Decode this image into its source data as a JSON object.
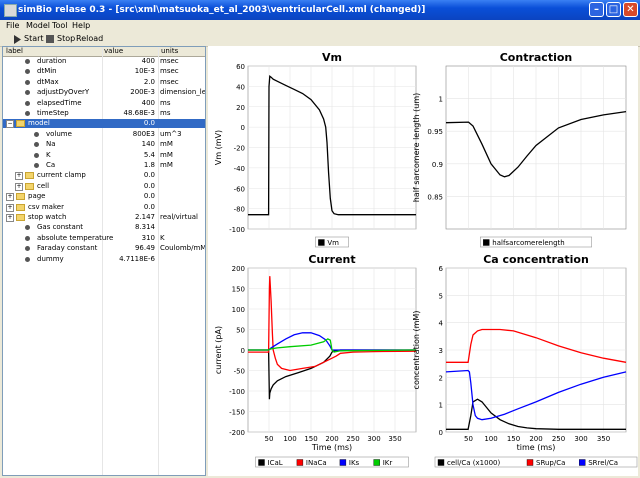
{
  "window": {
    "title": "simBio relase 0.3 - [src\\xml\\matsuoka_et_al_2003\\ventricularCell.xml (changed)]"
  },
  "menu": [
    "File",
    "Model",
    "Tool",
    "Help"
  ],
  "toolbar": {
    "start": "Start",
    "stop": "Stop",
    "reload": "Reload"
  },
  "tree": {
    "columns": [
      "label",
      "value",
      "units"
    ],
    "rows": [
      {
        "label": "duration",
        "value": "400",
        "units": "msec",
        "indent": 1,
        "kind": "leaf"
      },
      {
        "label": "dtMin",
        "value": "10E-3",
        "units": "msec",
        "indent": 1,
        "kind": "leaf"
      },
      {
        "label": "dtMax",
        "value": "2.0",
        "units": "msec",
        "indent": 1,
        "kind": "leaf"
      },
      {
        "label": "adjustDyOverY",
        "value": "200E-3",
        "units": "dimension_le...",
        "indent": 1,
        "kind": "leaf"
      },
      {
        "label": "elapsedTime",
        "value": "400",
        "units": "ms",
        "indent": 1,
        "kind": "leaf"
      },
      {
        "label": "timeStep",
        "value": "48.68E-3",
        "units": "ms",
        "indent": 1,
        "kind": "leaf"
      },
      {
        "label": "model",
        "value": "0.0",
        "units": "",
        "indent": 0,
        "kind": "folder-open",
        "selected": true
      },
      {
        "label": "volume",
        "value": "800E3",
        "units": "um^3",
        "indent": 2,
        "kind": "leaf"
      },
      {
        "label": "Na",
        "value": "140",
        "units": "mM",
        "indent": 2,
        "kind": "leaf"
      },
      {
        "label": "K",
        "value": "5.4",
        "units": "mM",
        "indent": 2,
        "kind": "leaf"
      },
      {
        "label": "Ca",
        "value": "1.8",
        "units": "mM",
        "indent": 2,
        "kind": "leaf"
      },
      {
        "label": "current clamp",
        "value": "0.0",
        "units": "",
        "indent": 1,
        "kind": "folder"
      },
      {
        "label": "cell",
        "value": "0.0",
        "units": "",
        "indent": 1,
        "kind": "folder"
      },
      {
        "label": "page",
        "value": "0.0",
        "units": "",
        "indent": 0,
        "kind": "folder"
      },
      {
        "label": "csv maker",
        "value": "0.0",
        "units": "",
        "indent": 0,
        "kind": "folder"
      },
      {
        "label": "stop watch",
        "value": "2.147",
        "units": "real/virtual",
        "indent": 0,
        "kind": "folder"
      },
      {
        "label": "Gas constant",
        "value": "8.314",
        "units": "",
        "indent": 1,
        "kind": "leaf"
      },
      {
        "label": "absolute temperature",
        "value": "310",
        "units": "K",
        "indent": 1,
        "kind": "leaf"
      },
      {
        "label": "Faraday constant",
        "value": "96.49",
        "units": "Coulomb/mM",
        "indent": 1,
        "kind": "leaf"
      },
      {
        "label": "dummy",
        "value": "4.7118E-6",
        "units": "",
        "indent": 1,
        "kind": "leaf"
      }
    ]
  },
  "chart_data": [
    {
      "type": "line",
      "title": "Vm",
      "xlabel": "",
      "ylabel": "Vm (mV)",
      "xlim": [
        0,
        400
      ],
      "ylim": [
        -100,
        60
      ],
      "yticks": [
        -100,
        -80,
        -60,
        -40,
        -20,
        0,
        20,
        40,
        60
      ],
      "grid": true,
      "legend": "bottom",
      "series": [
        {
          "name": "Vm",
          "color": "#000000",
          "x": [
            0,
            49,
            50,
            52,
            55,
            60,
            70,
            90,
            110,
            130,
            150,
            170,
            180,
            185,
            188,
            192,
            196,
            200,
            205,
            215,
            250,
            300,
            350,
            400
          ],
          "y": [
            -86,
            -86,
            40,
            50,
            49,
            47,
            45,
            41,
            37,
            33,
            27,
            17,
            8,
            0,
            -15,
            -45,
            -70,
            -82,
            -85,
            -86,
            -86,
            -86,
            -86,
            -86
          ]
        }
      ]
    },
    {
      "type": "line",
      "title": "Contraction",
      "xlabel": "",
      "ylabel": "half sarcomere length (um)",
      "xlim": [
        0,
        400
      ],
      "ylim": [
        0.8,
        1.05
      ],
      "yticks": [
        0.85,
        0.9,
        0.95,
        1.0
      ],
      "grid": true,
      "legend": "bottom",
      "series": [
        {
          "name": "halfsarcomerelength",
          "color": "#000000",
          "x": [
            0,
            50,
            60,
            80,
            100,
            120,
            130,
            140,
            160,
            180,
            200,
            250,
            300,
            350,
            400
          ],
          "y": [
            0.963,
            0.964,
            0.958,
            0.93,
            0.9,
            0.883,
            0.88,
            0.882,
            0.895,
            0.912,
            0.928,
            0.955,
            0.968,
            0.975,
            0.98
          ]
        }
      ]
    },
    {
      "type": "line",
      "title": "Current",
      "xlabel": "Time (ms)",
      "ylabel": "current (pA)",
      "xlim": [
        0,
        400
      ],
      "ylim": [
        -200,
        200
      ],
      "yticks": [
        -200,
        -150,
        -100,
        -50,
        0,
        50,
        100,
        150,
        200
      ],
      "xticks": [
        50,
        100,
        150,
        200,
        250,
        300,
        350
      ],
      "grid": true,
      "legend": "bottom",
      "series": [
        {
          "name": "ICaL",
          "color": "#000000",
          "x": [
            0,
            49,
            51,
            52,
            55,
            60,
            70,
            90,
            120,
            150,
            180,
            195,
            200,
            205,
            220,
            400
          ],
          "y": [
            0,
            0,
            -120,
            -105,
            -95,
            -85,
            -75,
            -65,
            -55,
            -45,
            -30,
            -15,
            -5,
            -2,
            0,
            0
          ]
        },
        {
          "name": "INaCa",
          "color": "#ff0000",
          "x": [
            0,
            49,
            51,
            52,
            55,
            58,
            60,
            65,
            70,
            80,
            100,
            130,
            160,
            180,
            200,
            210,
            220,
            250,
            300,
            400
          ],
          "y": [
            -5,
            -5,
            150,
            180,
            120,
            40,
            0,
            -20,
            -35,
            -45,
            -50,
            -45,
            -40,
            -30,
            -20,
            -15,
            -8,
            -5,
            -4,
            -3
          ]
        },
        {
          "name": "IKs",
          "color": "#0000ff",
          "x": [
            0,
            49,
            55,
            70,
            90,
            110,
            130,
            150,
            170,
            185,
            195,
            200,
            210,
            250,
            400
          ],
          "y": [
            0,
            0,
            5,
            15,
            27,
            37,
            42,
            42,
            35,
            25,
            10,
            0,
            0,
            0,
            0
          ]
        },
        {
          "name": "IKr",
          "color": "#00cc00",
          "x": [
            0,
            49,
            55,
            70,
            100,
            150,
            180,
            190,
            196,
            200,
            205,
            220,
            400
          ],
          "y": [
            0,
            0,
            3,
            5,
            8,
            12,
            20,
            27,
            24,
            0,
            -5,
            -2,
            0
          ]
        }
      ]
    },
    {
      "type": "line",
      "title": "Ca concentration",
      "xlabel": "time (ms)",
      "ylabel": "concentration (mM)",
      "xlim": [
        0,
        400
      ],
      "ylim": [
        0,
        6
      ],
      "yticks": [
        0,
        1,
        2,
        3,
        4,
        5,
        6
      ],
      "xticks": [
        50,
        100,
        150,
        200,
        250,
        300,
        350
      ],
      "grid": true,
      "legend": "bottom",
      "series": [
        {
          "name": "cell/Ca (x1000)",
          "color": "#000000",
          "x": [
            0,
            49,
            55,
            60,
            70,
            80,
            90,
            100,
            120,
            140,
            160,
            180,
            200,
            250,
            300,
            400
          ],
          "y": [
            0.1,
            0.1,
            0.6,
            1.1,
            1.2,
            1.1,
            0.9,
            0.7,
            0.45,
            0.3,
            0.2,
            0.15,
            0.12,
            0.1,
            0.1,
            0.1
          ]
        },
        {
          "name": "SRup/Ca",
          "color": "#ff0000",
          "x": [
            0,
            49,
            55,
            60,
            70,
            80,
            100,
            120,
            150,
            200,
            250,
            300,
            350,
            400
          ],
          "y": [
            2.55,
            2.55,
            3.2,
            3.55,
            3.7,
            3.75,
            3.75,
            3.75,
            3.7,
            3.45,
            3.15,
            2.9,
            2.7,
            2.55
          ]
        },
        {
          "name": "SRrel/Ca",
          "color": "#0000ff",
          "x": [
            0,
            49,
            52,
            55,
            60,
            65,
            70,
            80,
            100,
            130,
            160,
            200,
            250,
            300,
            350,
            400
          ],
          "y": [
            2.2,
            2.25,
            2.2,
            1.8,
            1.0,
            0.6,
            0.5,
            0.45,
            0.5,
            0.65,
            0.85,
            1.1,
            1.45,
            1.75,
            2.0,
            2.2
          ]
        }
      ]
    }
  ]
}
